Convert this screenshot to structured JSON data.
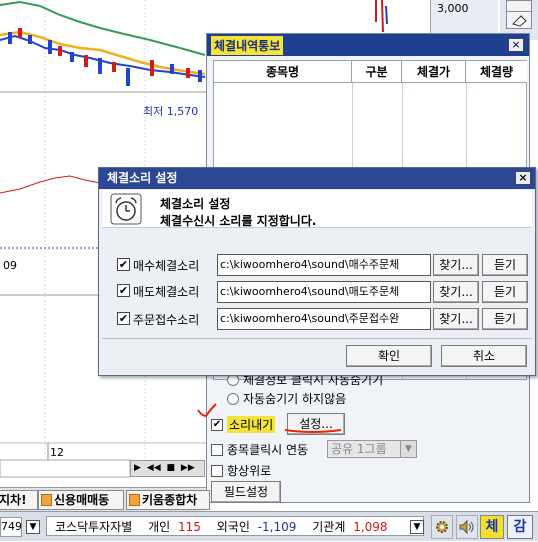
{
  "background_chart": {
    "price_top": "3,000",
    "low_label": "최저 1,570",
    "date_left": "09",
    "date_mid": "12"
  },
  "notice_window": {
    "title": "체결내역통보",
    "close_label": "×",
    "columns": [
      "종목명",
      "구분",
      "체결가",
      "체결량"
    ],
    "options": {
      "radio_auto_hide": "체결정보 클릭시 자동숨기기",
      "radio_no_hide": "자동숨기기 하지않음",
      "sound_checkbox": "소리내기",
      "sound_checked_mark": "✔",
      "settings_button": "설정...",
      "link_checkbox": "종목클릭시 연동",
      "link_combo": "공유 1그룹",
      "always_top_checkbox": "항상위로",
      "field_settings_button": "필드설정"
    }
  },
  "sound_dialog": {
    "title": "체결소리 설정",
    "close_label": "×",
    "header_title": "체결소리 설정",
    "header_subtitle": "체결수신시 소리를 지정합니다.",
    "rows": [
      {
        "label": "매수체결소리",
        "checked": "✔",
        "path": "c:\\kiwoomhero4\\sound\\매수주문체",
        "find": "찾기...",
        "listen": "듣기"
      },
      {
        "label": "매도체결소리",
        "checked": "✔",
        "path": "c:\\kiwoomhero4\\sound\\매도주문체",
        "find": "찾기...",
        "listen": "듣기"
      },
      {
        "label": "주문접수소리",
        "checked": "✔",
        "path": "c:\\kiwoomhero4\\sound\\주문접수완",
        "find": "찾기...",
        "listen": "듣기"
      }
    ],
    "ok_button": "확인",
    "cancel_button": "취소"
  },
  "bottom_tabs": {
    "tab1": "지차!",
    "tab2": "신용매매동",
    "tab3": "키움종합차"
  },
  "status_bar": {
    "left_value": "749",
    "investor_label": "코스닥투자자별",
    "individual_label": "개인",
    "individual_value": "115",
    "foreign_label": "외국인",
    "foreign_value": "-1,109",
    "institution_label": "기관계",
    "institution_value": "1,098",
    "btn_che": "체",
    "btn_gam": "감"
  },
  "colors": {
    "title_bar": "#1f3f8f",
    "notice_title_highlight": "#f3e33a",
    "value_red": "#d21a1a",
    "dialog_title_bar": "#2c4795",
    "active_status_button": "#f2e030"
  },
  "icons": [
    "alarm-clock-icon",
    "gear-icon",
    "speaker-icon",
    "chevron-down-icon",
    "close-icon",
    "eraser-icon"
  ]
}
